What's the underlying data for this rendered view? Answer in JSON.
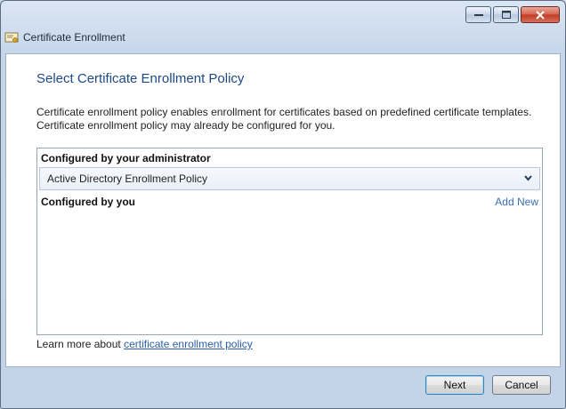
{
  "window": {
    "title": "Certificate Enrollment",
    "controls": [
      "minimize-icon",
      "maximize-icon",
      "close-icon"
    ]
  },
  "page": {
    "heading": "Select Certificate Enrollment Policy",
    "description_line1": "Certificate enrollment policy enables enrollment for certificates based on predefined certificate templates.",
    "description_line2": "Certificate enrollment policy may already be configured for you."
  },
  "admin_section": {
    "label": "Configured by your administrator",
    "selected_policy": "Active Directory Enrollment Policy"
  },
  "user_section": {
    "label": "Configured by you",
    "add_new_link": "Add New"
  },
  "learn_more": {
    "prefix": "Learn more about ",
    "link_text": "certificate enrollment policy"
  },
  "footer": {
    "next_label": "Next",
    "cancel_label": "Cancel"
  },
  "colors": {
    "heading": "#1d4a86",
    "link": "#2a5ea8",
    "accent": "#3d6fb1"
  }
}
